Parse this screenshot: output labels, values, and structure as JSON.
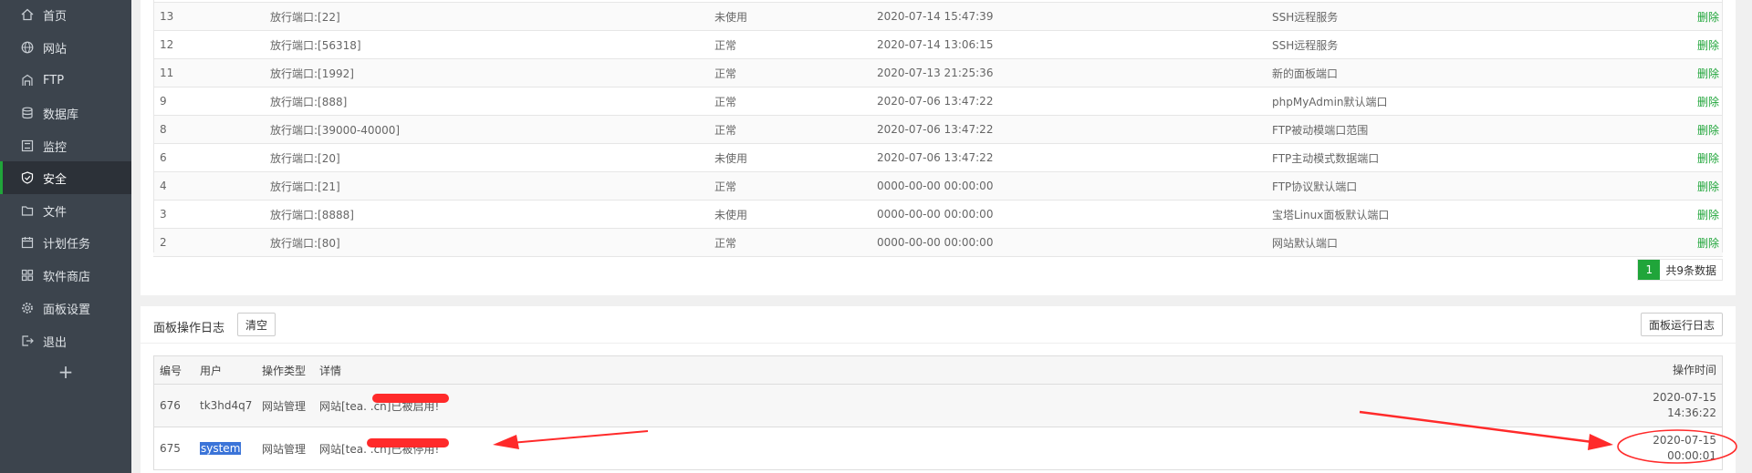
{
  "sidebar": {
    "items": [
      {
        "label": "首页",
        "icon": "home-icon",
        "active": false
      },
      {
        "label": "网站",
        "icon": "globe-icon",
        "active": false
      },
      {
        "label": "FTP",
        "icon": "ftp-icon",
        "active": false
      },
      {
        "label": "数据库",
        "icon": "database-icon",
        "active": false
      },
      {
        "label": "监控",
        "icon": "monitor-icon",
        "active": false
      },
      {
        "label": "安全",
        "icon": "shield-icon",
        "active": true
      },
      {
        "label": "文件",
        "icon": "folder-icon",
        "active": false
      },
      {
        "label": "计划任务",
        "icon": "calendar-icon",
        "active": false
      },
      {
        "label": "软件商店",
        "icon": "grid-icon",
        "active": false
      },
      {
        "label": "面板设置",
        "icon": "gear-icon",
        "active": false
      },
      {
        "label": "退出",
        "icon": "logout-icon",
        "active": false
      }
    ],
    "add_label": "+"
  },
  "firewall": {
    "rows": [
      {
        "id": "13",
        "rule": "放行端口:[22]",
        "status": "未使用",
        "time": "2020-07-14 15:47:39",
        "note": "SSH远程服务",
        "action": "删除"
      },
      {
        "id": "12",
        "rule": "放行端口:[56318]",
        "status": "正常",
        "time": "2020-07-14 13:06:15",
        "note": "SSH远程服务",
        "action": "删除"
      },
      {
        "id": "11",
        "rule": "放行端口:[1992]",
        "status": "正常",
        "time": "2020-07-13 21:25:36",
        "note": "新的面板端口",
        "action": "删除"
      },
      {
        "id": "9",
        "rule": "放行端口:[888]",
        "status": "正常",
        "time": "2020-07-06 13:47:22",
        "note": "phpMyAdmin默认端口",
        "action": "删除"
      },
      {
        "id": "8",
        "rule": "放行端口:[39000-40000]",
        "status": "正常",
        "time": "2020-07-06 13:47:22",
        "note": "FTP被动模端口范围",
        "action": "删除"
      },
      {
        "id": "6",
        "rule": "放行端口:[20]",
        "status": "未使用",
        "time": "2020-07-06 13:47:22",
        "note": "FTP主动模式数据端口",
        "action": "删除"
      },
      {
        "id": "4",
        "rule": "放行端口:[21]",
        "status": "正常",
        "time": "0000-00-00 00:00:00",
        "note": "FTP协议默认端口",
        "action": "删除"
      },
      {
        "id": "3",
        "rule": "放行端口:[8888]",
        "status": "未使用",
        "time": "0000-00-00 00:00:00",
        "note": "宝塔Linux面板默认端口",
        "action": "删除"
      },
      {
        "id": "2",
        "rule": "放行端口:[80]",
        "status": "正常",
        "time": "0000-00-00 00:00:00",
        "note": "网站默认端口",
        "action": "删除"
      }
    ],
    "pager": {
      "current": "1",
      "total": "共9条数据"
    }
  },
  "log": {
    "title": "面板操作日志",
    "clear_label": "清空",
    "runlog_label": "面板运行日志",
    "columns": {
      "id": "编号",
      "user": "用户",
      "type": "操作类型",
      "detail": "详情",
      "time": "操作时间"
    },
    "rows": [
      {
        "id": "676",
        "user": "tk3hd4q7",
        "type": "网站管理",
        "detail": "网站[tea.          .cn]已被启用!",
        "date": "2020-07-15",
        "clock": "14:36:22"
      },
      {
        "id": "675",
        "user": "system",
        "type": "网站管理",
        "detail": "网站[tea.          .cn]已被停用!",
        "date": "2020-07-15",
        "clock": "00:00:01"
      }
    ]
  },
  "colors": {
    "accent": "#20a53a",
    "sidebar": "#3c444d",
    "annotation": "#ff2a2a"
  }
}
